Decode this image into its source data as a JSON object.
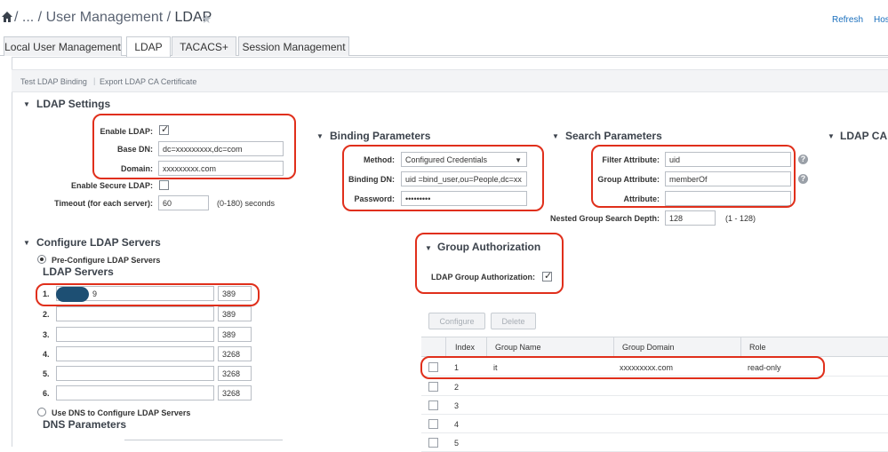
{
  "header": {
    "breadcrumb_prefix": "/ ... / User Management /",
    "page_title": "LDAP",
    "refresh_label": "Refresh",
    "host_label": "Hos"
  },
  "tabs": [
    {
      "label": "Local User Management",
      "active": false
    },
    {
      "label": "LDAP",
      "active": true
    },
    {
      "label": "TACACS+",
      "active": false
    },
    {
      "label": "Session Management",
      "active": false
    }
  ],
  "toolbar": {
    "test_binding": "Test LDAP Binding",
    "separator": "|",
    "export_cert": "Export LDAP CA Certificate"
  },
  "ldap_settings": {
    "title": "LDAP Settings",
    "enable_ldap_label": "Enable LDAP:",
    "enable_ldap_checked": true,
    "base_dn_label": "Base DN:",
    "base_dn_value": "dc=xxxxxxxxx,dc=com",
    "domain_label": "Domain:",
    "domain_value": "xxxxxxxxx.com",
    "enable_secure_label": "Enable Secure LDAP:",
    "enable_secure_checked": false,
    "timeout_label": "Timeout (for each server):",
    "timeout_value": "60",
    "timeout_hint": "(0-180) seconds"
  },
  "binding": {
    "title": "Binding Parameters",
    "method_label": "Method:",
    "method_value": "Configured Credentials",
    "binding_dn_label": "Binding DN:",
    "binding_dn_value": "uid =bind_user,ou=People,dc=xx",
    "password_label": "Password:",
    "password_value": "•••••••••"
  },
  "search": {
    "title": "Search Parameters",
    "filter_label": "Filter Attribute:",
    "filter_value": "uid",
    "group_label": "Group Attribute:",
    "group_value": "memberOf",
    "attribute_label": "Attribute:",
    "attribute_value": "",
    "nested_label": "Nested Group Search Depth:",
    "nested_value": "128",
    "nested_hint": "(1 - 128)"
  },
  "ldap_ca": {
    "title": "LDAP CA"
  },
  "servers": {
    "title": "Configure LDAP Servers",
    "preconfig_label": "Pre-Configure LDAP Servers",
    "preconfig_selected": true,
    "list_title": "LDAP Servers",
    "rows": [
      {
        "num": "1.",
        "host": "9",
        "port": "389"
      },
      {
        "num": "2.",
        "host": "",
        "port": "389"
      },
      {
        "num": "3.",
        "host": "",
        "port": "389"
      },
      {
        "num": "4.",
        "host": "",
        "port": "3268"
      },
      {
        "num": "5.",
        "host": "",
        "port": "3268"
      },
      {
        "num": "6.",
        "host": "",
        "port": "3268"
      }
    ],
    "dns_label": "Use DNS to Configure LDAP Servers",
    "dns_selected": false,
    "dns_title": "DNS Parameters"
  },
  "group_auth": {
    "title": "Group Authorization",
    "label": "LDAP Group Authorization:",
    "checked": true
  },
  "group_table": {
    "configure_button": "Configure",
    "delete_button": "Delete",
    "columns": [
      "Index",
      "Group Name",
      "Group Domain",
      "Role"
    ],
    "rows": [
      {
        "index": "1",
        "group_name": "it",
        "group_domain": "xxxxxxxxx.com",
        "role": "read-only"
      },
      {
        "index": "2",
        "group_name": "",
        "group_domain": "",
        "role": ""
      },
      {
        "index": "3",
        "group_name": "",
        "group_domain": "",
        "role": ""
      },
      {
        "index": "4",
        "group_name": "",
        "group_domain": "",
        "role": ""
      },
      {
        "index": "5",
        "group_name": "",
        "group_domain": "",
        "role": ""
      }
    ]
  },
  "colors": {
    "highlight": "#e02f1b",
    "link": "#1a6fbd",
    "redaction": "#1d4f73"
  }
}
